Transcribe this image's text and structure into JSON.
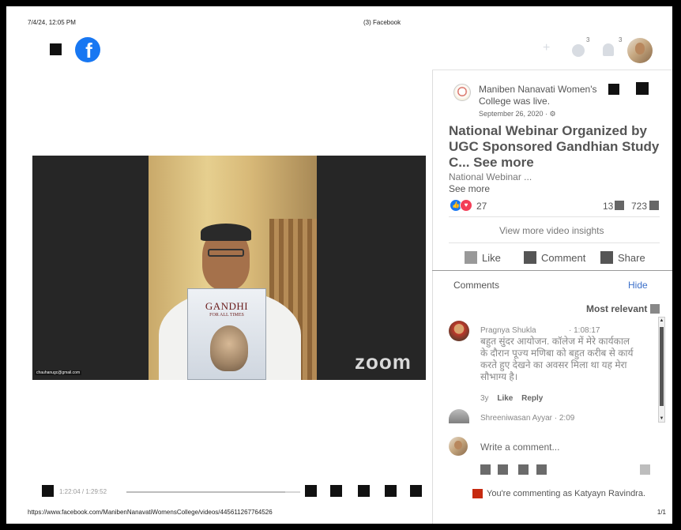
{
  "print_header": {
    "datetime": "7/4/24, 12:05 PM",
    "tab_title": "(3) Facebook"
  },
  "print_footer": {
    "url": "https://www.facebook.com/ManibenNanavatiWomensCollege/videos/445611267764526",
    "page": "1/1"
  },
  "top_nav": {
    "logo_icon": "facebook-logo-icon",
    "plus": "+",
    "messenger_badge": "3",
    "notifications_badge": "3"
  },
  "video": {
    "book_title": "GANDHI",
    "book_subtitle": "FOR ALL TIMES",
    "zoom_label": "zoom",
    "email": "chauhanugc@gmail.com",
    "time": "1:22:04 / 1:29:52",
    "progress_fraction": 0.913
  },
  "post": {
    "page_name": "Maniben Nanavati Women's College",
    "live_text": " was live.",
    "date": "September 26, 2020 · ⚙",
    "title": "National Webinar Organized by UGC Sponsored Gandhian Study C... See more",
    "description": "National Webinar ...",
    "see_more": "See more",
    "reactions_count": "27",
    "comments_count": "13",
    "shares_count": "723",
    "insights": "View more video insights",
    "like_label": "Like",
    "comment_label": "Comment",
    "share_label": "Share"
  },
  "comments": {
    "title": "Comments",
    "hide": "Hide",
    "sort": "Most relevant",
    "items": [
      {
        "author": "Pragnya Shukla",
        "time": "1:08:17",
        "text": "बहुत सुंदर आयोजन. कॉलेज में मेरे कार्यकाल के दौरान पूज्य मणिबा को बहुत करीब से कार्य करते हुए देखने का अवसर मिला था यह मेरा सौभाग्य है।",
        "age": "3y",
        "like": "Like",
        "reply": "Reply"
      },
      {
        "author": "Shreeniwasan Ayyar",
        "time": "· 2:09"
      }
    ],
    "write_placeholder": "Write a comment...",
    "commenting_as": "You're commenting as Katyayn Ravindra."
  }
}
